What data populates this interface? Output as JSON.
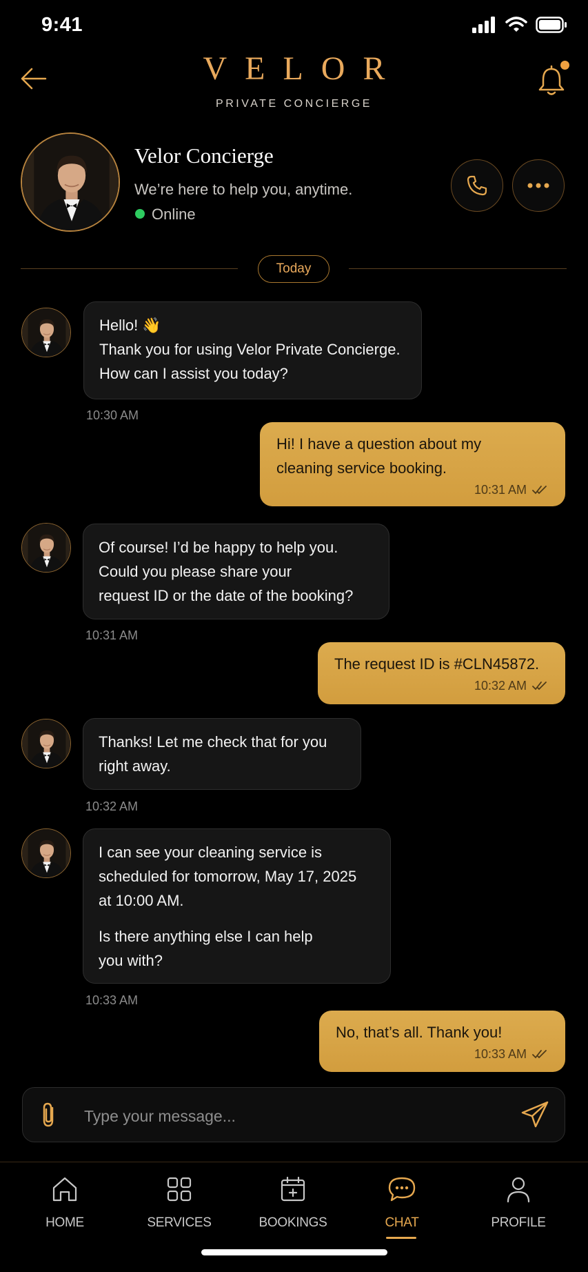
{
  "status_bar": {
    "time": "9:41"
  },
  "header": {
    "brand": "VELOR",
    "subtitle": "PRIVATE CONCIERGE"
  },
  "concierge": {
    "name": "Velor Concierge",
    "tagline": "We’re here to help you, anytime.",
    "status": "Online"
  },
  "divider": {
    "label": "Today"
  },
  "messages": [
    {
      "from": "concierge",
      "lines": [
        "Hello! 👋",
        "Thank you for using Velor Private Concierge.",
        "How can I assist you today?"
      ],
      "time": "10:30 AM"
    },
    {
      "from": "user",
      "lines": [
        "Hi! I have a question about my",
        "cleaning service booking."
      ],
      "time": "10:31 AM"
    },
    {
      "from": "concierge",
      "lines": [
        "Of course! I’d be happy to help you.",
        "Could you please share your",
        "request ID or the date of the booking?"
      ],
      "time": "10:31 AM"
    },
    {
      "from": "user",
      "lines": [
        "The request ID is #CLN45872."
      ],
      "time": "10:32 AM"
    },
    {
      "from": "concierge",
      "lines": [
        "Thanks! Let me check that for you",
        "right away."
      ],
      "time": "10:32 AM"
    },
    {
      "from": "concierge",
      "lines": [
        "I can see your cleaning service is",
        "scheduled for tomorrow, May 17, 2025",
        "at 10:00 AM."
      ],
      "lines2": [
        "Is there anything else I can help",
        "you with?"
      ],
      "time": "10:33 AM"
    },
    {
      "from": "user",
      "lines": [
        "No, that’s all. Thank you!"
      ],
      "time": "10:33 AM"
    }
  ],
  "composer": {
    "placeholder": "Type your message..."
  },
  "tabs": [
    {
      "label": "HOME",
      "icon": "home-icon"
    },
    {
      "label": "SERVICES",
      "icon": "grid-icon"
    },
    {
      "label": "BOOKINGS",
      "icon": "calendar-icon"
    },
    {
      "label": "CHAT",
      "icon": "chat-icon",
      "active": true
    },
    {
      "label": "PROFILE",
      "icon": "person-icon"
    }
  ],
  "colors": {
    "accent": "#e6a84f",
    "user_bubble": "#d9a647",
    "online": "#2ecc60"
  }
}
